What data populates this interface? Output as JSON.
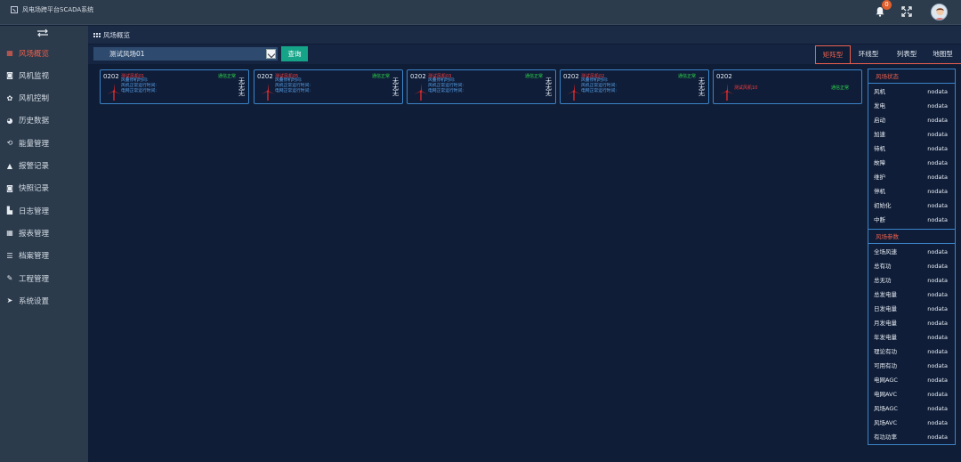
{
  "app": {
    "title": "风电场跨平台SCADA系统",
    "notification_count": "0"
  },
  "sidebar": {
    "items": [
      {
        "label": "风场概览",
        "icon": "grid-icon",
        "active": true
      },
      {
        "label": "风机监视",
        "icon": "camera-icon"
      },
      {
        "label": "风机控制",
        "icon": "gear-icon"
      },
      {
        "label": "历史数据",
        "icon": "pie-icon"
      },
      {
        "label": "能量管理",
        "icon": "energy-icon"
      },
      {
        "label": "报警记录",
        "icon": "bell-icon"
      },
      {
        "label": "快照记录",
        "icon": "camera-icon"
      },
      {
        "label": "日志管理",
        "icon": "file-icon"
      },
      {
        "label": "报表管理",
        "icon": "table-icon"
      },
      {
        "label": "档案管理",
        "icon": "list-icon"
      },
      {
        "label": "工程管理",
        "icon": "wrench-icon"
      },
      {
        "label": "系统设置",
        "icon": "send-icon"
      }
    ]
  },
  "breadcrumb": {
    "label": "风场概览"
  },
  "toolbar": {
    "farm_selected": "测试风场01",
    "query_label": "查询"
  },
  "view_tabs": [
    {
      "label": "矩阵型",
      "active": true
    },
    {
      "label": "环线型"
    },
    {
      "label": "列表型"
    },
    {
      "label": "地图型"
    }
  ],
  "turbines": [
    {
      "code": "0202",
      "name": "测试风机01",
      "status": "通信正常",
      "rows": [
        "风叠停机时间:",
        "风机正常运行时间:",
        "电网正常运行时间:"
      ],
      "vals": [
        "无",
        "无",
        "无"
      ]
    },
    {
      "code": "0202",
      "name": "测试风机05",
      "status": "通信正常",
      "rows": [
        "风叠停机时间:",
        "风机正常运行时间:",
        "电网正常运行时间:"
      ],
      "vals": [
        "无",
        "无",
        "无"
      ]
    },
    {
      "code": "0202",
      "name": "测试风机03",
      "status": "通信正常",
      "rows": [
        "风叠停机时间:",
        "风机正常运行时间:",
        "电网正常运行时间:"
      ],
      "vals": [
        "无",
        "无",
        "无"
      ]
    },
    {
      "code": "0202",
      "name": "测试风机02",
      "status": "通信正常",
      "rows": [
        "风叠停机时间:",
        "风机正常运行时间:",
        "电网正常运行时间:"
      ],
      "vals": [
        "无",
        "无",
        "无"
      ]
    },
    {
      "code": "0202",
      "name": "测试风机10",
      "status": "通信正常",
      "rows": [
        "",
        "",
        ""
      ],
      "vals": [
        "",
        "",
        ""
      ]
    }
  ],
  "farm_status": {
    "title": "风场状态",
    "rows": [
      {
        "k": "风机",
        "v": "nodata"
      },
      {
        "k": "发电",
        "v": "nodata"
      },
      {
        "k": "启动",
        "v": "nodata"
      },
      {
        "k": "加速",
        "v": "nodata"
      },
      {
        "k": "待机",
        "v": "nodata"
      },
      {
        "k": "故障",
        "v": "nodata"
      },
      {
        "k": "维护",
        "v": "nodata"
      },
      {
        "k": "停机",
        "v": "nodata"
      },
      {
        "k": "初始化",
        "v": "nodata"
      },
      {
        "k": "中断",
        "v": "nodata"
      }
    ]
  },
  "farm_params": {
    "title": "风场参数",
    "rows": [
      {
        "k": "全场风速",
        "v": "nodata"
      },
      {
        "k": "总有功",
        "v": "nodata"
      },
      {
        "k": "总无功",
        "v": "nodata"
      },
      {
        "k": "总发电量",
        "v": "nodata"
      },
      {
        "k": "日发电量",
        "v": "nodata"
      },
      {
        "k": "月发电量",
        "v": "nodata"
      },
      {
        "k": "年发电量",
        "v": "nodata"
      },
      {
        "k": "理论有功",
        "v": "nodata"
      },
      {
        "k": "可用有功",
        "v": "nodata"
      },
      {
        "k": "电网AGC",
        "v": "nodata"
      },
      {
        "k": "电网AVC",
        "v": "nodata"
      },
      {
        "k": "风场AGC",
        "v": "nodata"
      },
      {
        "k": "风场AVC",
        "v": "nodata"
      },
      {
        "k": "有功功率",
        "v": "nodata"
      }
    ]
  },
  "colors": {
    "accent": "#ea5f4d",
    "ok": "#2bd84a",
    "border": "#3b84c8",
    "query": "#15a488"
  }
}
